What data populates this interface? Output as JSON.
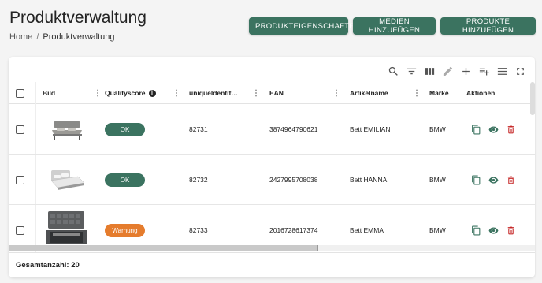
{
  "header": {
    "title": "Produktverwaltung",
    "breadcrumb": {
      "home": "Home",
      "separator": "/",
      "current": "Produktverwaltung"
    },
    "buttons": {
      "properties": "PRODUKTEIGENSCHAFTEN",
      "add_media": "MEDIEN HINZUFÜGEN",
      "add_products": "PRODUKTE HINZUFÜGEN"
    }
  },
  "toolbar": [
    "search-icon",
    "filter-icon",
    "columns-icon",
    "edit-icon",
    "add-icon",
    "playlist-add-icon",
    "density-icon",
    "fullscreen-icon"
  ],
  "table": {
    "columns": {
      "image": "Bild",
      "quality": "Qualityscore",
      "uid": "uniqueldentif…",
      "ean": "EAN",
      "name": "Artikelname",
      "brand": "Marke",
      "actions": "Aktionen"
    },
    "rows": [
      {
        "uid": "82731",
        "ean": "3874964790621",
        "name": "Bett EMILIAN",
        "brand": "BMW",
        "quality": "OK",
        "status": "ok"
      },
      {
        "uid": "82732",
        "ean": "2427995708038",
        "name": "Bett HANNA",
        "brand": "BMW",
        "quality": "OK",
        "status": "ok"
      },
      {
        "uid": "82733",
        "ean": "2016728617374",
        "name": "Bett EMMA",
        "brand": "BMW",
        "quality": "Warnung",
        "status": "warn"
      }
    ]
  },
  "footer": {
    "total": "Gesamtanzahl: 20"
  },
  "colors": {
    "primary": "#3b7360",
    "warning": "#e57c2d",
    "delete": "#c62828"
  }
}
